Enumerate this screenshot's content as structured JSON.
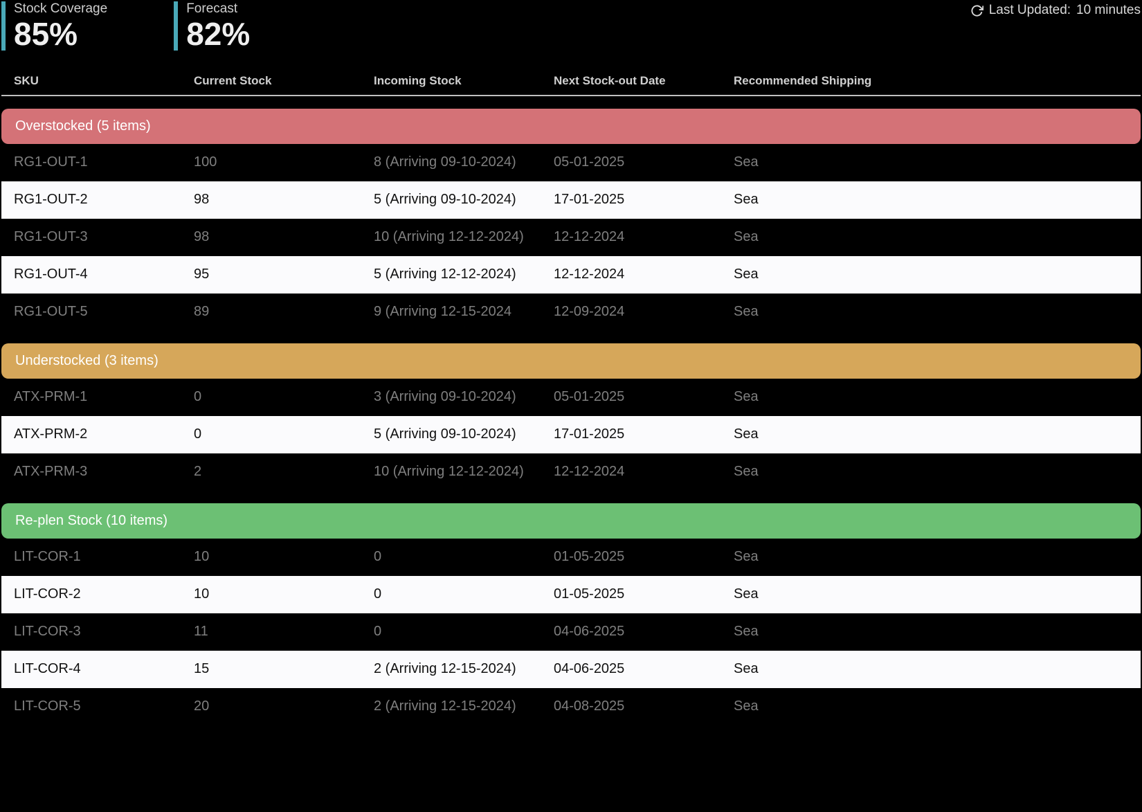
{
  "kpis": [
    {
      "label": "Stock Coverage",
      "value": "85%"
    },
    {
      "label": "Forecast",
      "value": "82%"
    }
  ],
  "last_updated": {
    "prefix": "Last Updated:",
    "value": "10 minutes"
  },
  "columns": [
    "SKU",
    "Current Stock",
    "Incoming Stock",
    "Next Stock-out Date",
    "Recommended Shipping"
  ],
  "groups": [
    {
      "title": "Overstocked (5 items)",
      "variant": "over",
      "rows": [
        {
          "sku": "RG1-OUT-1",
          "current": "100",
          "incoming": "8 (Arriving 09-10-2024)",
          "stockout": "05-01-2025",
          "ship": "Sea"
        },
        {
          "sku": "RG1-OUT-2",
          "current": "98",
          "incoming": "5 (Arriving 09-10-2024)",
          "stockout": "17-01-2025",
          "ship": "Sea"
        },
        {
          "sku": "RG1-OUT-3",
          "current": "98",
          "incoming": "10 (Arriving 12-12-2024)",
          "stockout": "12-12-2024",
          "ship": "Sea"
        },
        {
          "sku": "RG1-OUT-4",
          "current": "95",
          "incoming": "5 (Arriving 12-12-2024)",
          "stockout": "12-12-2024",
          "ship": "Sea"
        },
        {
          "sku": "RG1-OUT-5",
          "current": "89",
          "incoming": "9 (Arriving 12-15-2024",
          "stockout": "12-09-2024",
          "ship": "Sea"
        }
      ]
    },
    {
      "title": "Understocked (3 items)",
      "variant": "under",
      "rows": [
        {
          "sku": "ATX-PRM-1",
          "current": "0",
          "incoming": "3 (Arriving 09-10-2024)",
          "stockout": "05-01-2025",
          "ship": "Sea"
        },
        {
          "sku": "ATX-PRM-2",
          "current": "0",
          "incoming": "5 (Arriving 09-10-2024)",
          "stockout": "17-01-2025",
          "ship": "Sea"
        },
        {
          "sku": "ATX-PRM-3",
          "current": "2",
          "incoming": "10 (Arriving 12-12-2024)",
          "stockout": "12-12-2024",
          "ship": "Sea"
        }
      ]
    },
    {
      "title": "Re-plen Stock (10 items)",
      "variant": "replen",
      "rows": [
        {
          "sku": "LIT-COR-1",
          "current": "10",
          "incoming": "0",
          "stockout": "01-05-2025",
          "ship": "Sea"
        },
        {
          "sku": "LIT-COR-2",
          "current": "10",
          "incoming": "0",
          "stockout": "01-05-2025",
          "ship": "Sea"
        },
        {
          "sku": "LIT-COR-3",
          "current": "11",
          "incoming": "0",
          "stockout": "04-06-2025",
          "ship": "Sea"
        },
        {
          "sku": "LIT-COR-4",
          "current": "15",
          "incoming": "2 (Arriving 12-15-2024)",
          "stockout": "04-06-2025",
          "ship": "Sea"
        },
        {
          "sku": "LIT-COR-5",
          "current": "20",
          "incoming": "2 (Arriving 12-15-2024)",
          "stockout": "04-08-2025",
          "ship": "Sea"
        }
      ]
    }
  ]
}
